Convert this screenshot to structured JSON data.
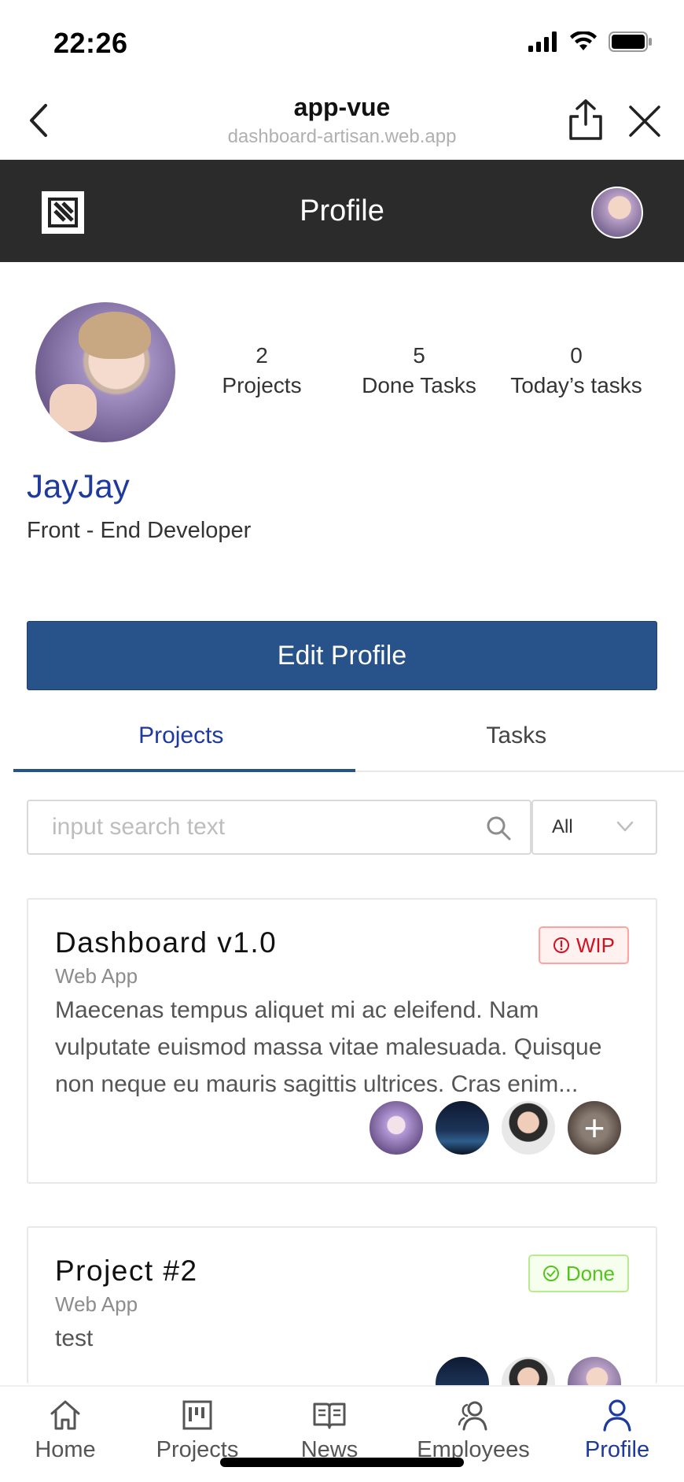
{
  "status_bar": {
    "time": "22:26"
  },
  "browser": {
    "title": "app-vue",
    "url": "dashboard-artisan.web.app"
  },
  "header": {
    "title": "Profile"
  },
  "profile": {
    "name": "JayJay",
    "role": "Front - End Developer",
    "stats": [
      {
        "value": "2",
        "label": "Projects"
      },
      {
        "value": "5",
        "label": "Done Tasks"
      },
      {
        "value": "0",
        "label": "Today’s tasks"
      }
    ],
    "edit_label": "Edit Profile"
  },
  "tabs": [
    {
      "label": "Projects",
      "active": true
    },
    {
      "label": "Tasks",
      "active": false
    }
  ],
  "search": {
    "placeholder": "input search text"
  },
  "filter": {
    "selected": "All"
  },
  "projects": [
    {
      "title": "Dashboard v1.0",
      "type": "Web App",
      "description": "Maecenas tempus aliquet mi ac eleifend. Nam vulputate euismod massa vitae malesuada. Quisque non neque eu mauris sagittis ultrices. Cras enim...",
      "status": "WIP",
      "status_color": "#cf1322",
      "more_members_symbol": "+"
    },
    {
      "title": "Project #2",
      "type": "Web App",
      "description": "test",
      "status": "Done",
      "status_color": "#52c41a"
    }
  ],
  "bottom_nav": [
    {
      "label": "Home",
      "icon": "home-icon"
    },
    {
      "label": "Projects",
      "icon": "kanban-icon"
    },
    {
      "label": "News",
      "icon": "book-icon"
    },
    {
      "label": "Employees",
      "icon": "people-icon"
    },
    {
      "label": "Profile",
      "icon": "user-icon",
      "active": true
    }
  ],
  "colors": {
    "header_bg": "#2b2b2b",
    "primary": "#27528a",
    "link": "#1e3a9e"
  }
}
